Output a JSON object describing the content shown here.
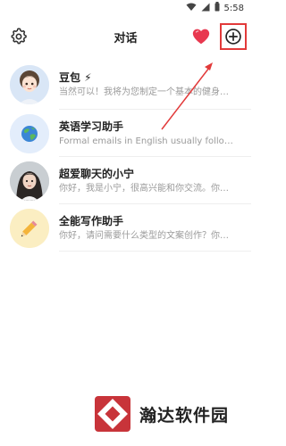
{
  "status_bar": {
    "time": "5:58",
    "icons": [
      "wifi-icon",
      "signal-icon",
      "battery-icon"
    ]
  },
  "header": {
    "title": "对话",
    "settings_icon": "gear-icon",
    "heart_icon": "heart-icon",
    "new_chat_icon": "plus-circle-icon"
  },
  "conversations": [
    {
      "name": "豆包 ⚡",
      "preview": "当然可以！我将为您制定一个基本的健身计划"
    },
    {
      "name": "英语学习助手",
      "preview": "Formal emails in English usually follow a certain structure"
    },
    {
      "name": "超爱聊天的小宁",
      "preview": "你好，我是小宁，很高兴能和你交流。你可以"
    },
    {
      "name": "全能写作助手",
      "preview": "你好，请问需要什么类型的文案创作？你可以"
    }
  ],
  "watermark": {
    "text": "瀚达软件园"
  },
  "colors": {
    "accent_red": "#e23a3a",
    "heart": "#e8384f"
  }
}
